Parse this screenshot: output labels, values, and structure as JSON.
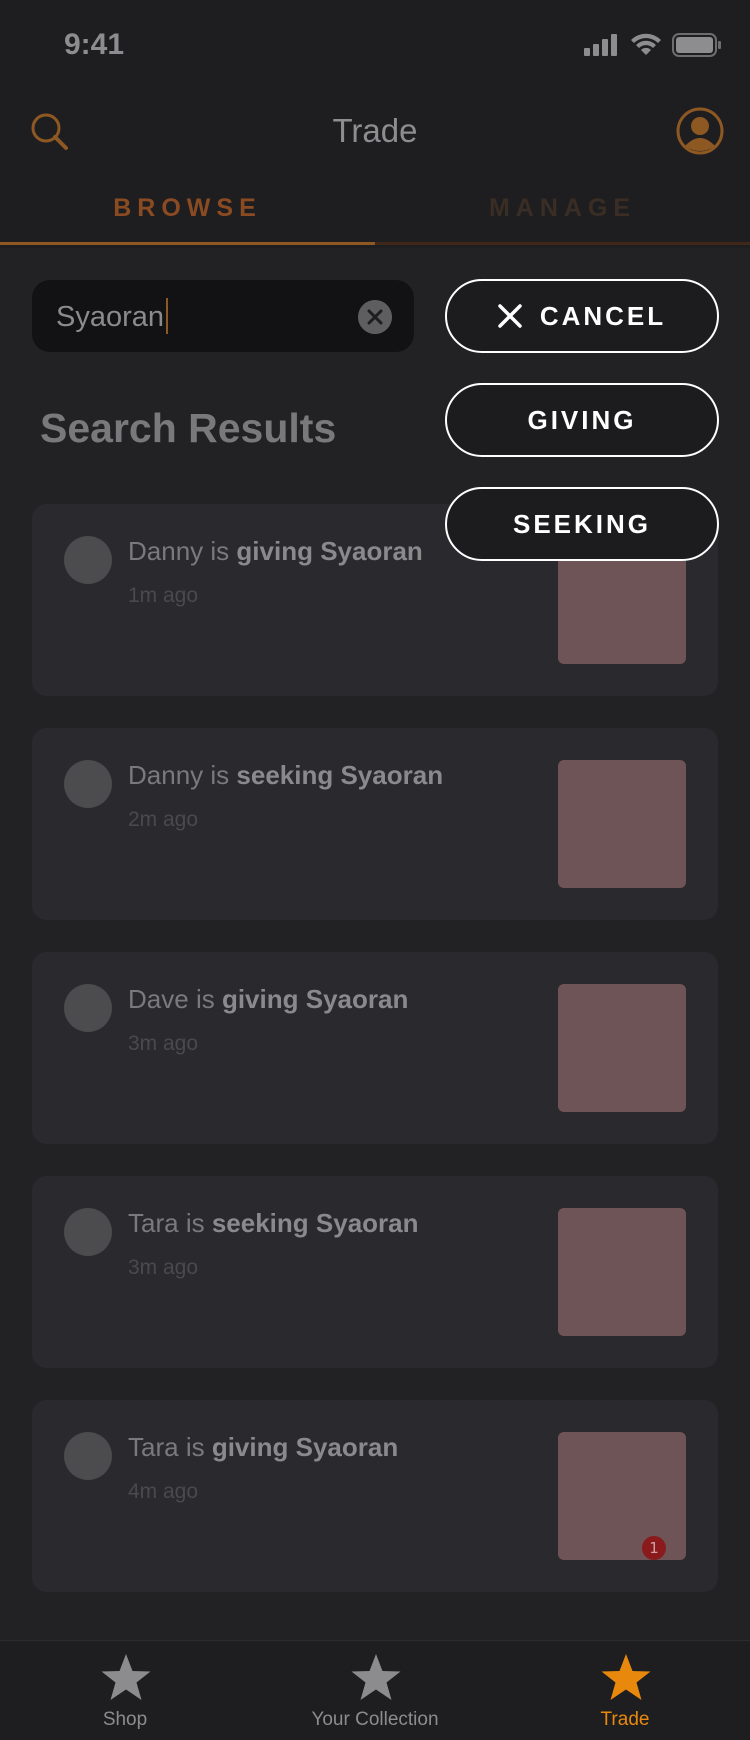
{
  "status_bar": {
    "time": "9:41"
  },
  "header": {
    "title": "Trade"
  },
  "tabs": [
    {
      "label": "BROWSE",
      "active": true
    },
    {
      "label": "MANAGE",
      "active": false
    }
  ],
  "search": {
    "value": "Syaoran"
  },
  "filter_menu": {
    "cancel_label": "CANCEL",
    "giving_label": "GIVING",
    "seeking_label": "SEEKING"
  },
  "results_title": "Search Results",
  "trades": [
    {
      "user": "Danny",
      "connector": "is",
      "action": "giving",
      "item": "Syaoran",
      "time": "1m ago"
    },
    {
      "user": "Danny",
      "connector": "is",
      "action": "seeking",
      "item": "Syaoran",
      "time": "2m ago"
    },
    {
      "user": "Dave",
      "connector": "is",
      "action": "giving",
      "item": "Syaoran",
      "time": "3m ago"
    },
    {
      "user": "Tara",
      "connector": "is",
      "action": "seeking",
      "item": "Syaoran",
      "time": "3m ago"
    },
    {
      "user": "Tara",
      "connector": "is",
      "action": "giving",
      "item": "Syaoran",
      "time": "4m ago",
      "badge": "1"
    }
  ],
  "tab_bar": [
    {
      "label": "Shop",
      "icon": "star-icon",
      "active": false
    },
    {
      "label": "Your Collection",
      "icon": "star-icon",
      "active": false
    },
    {
      "label": "Trade",
      "icon": "star-icon",
      "active": true
    }
  ],
  "colors": {
    "accent": "#e8890e",
    "tab_active": "#8a4b22",
    "background": "#222225",
    "card": "#2a2a2e"
  }
}
